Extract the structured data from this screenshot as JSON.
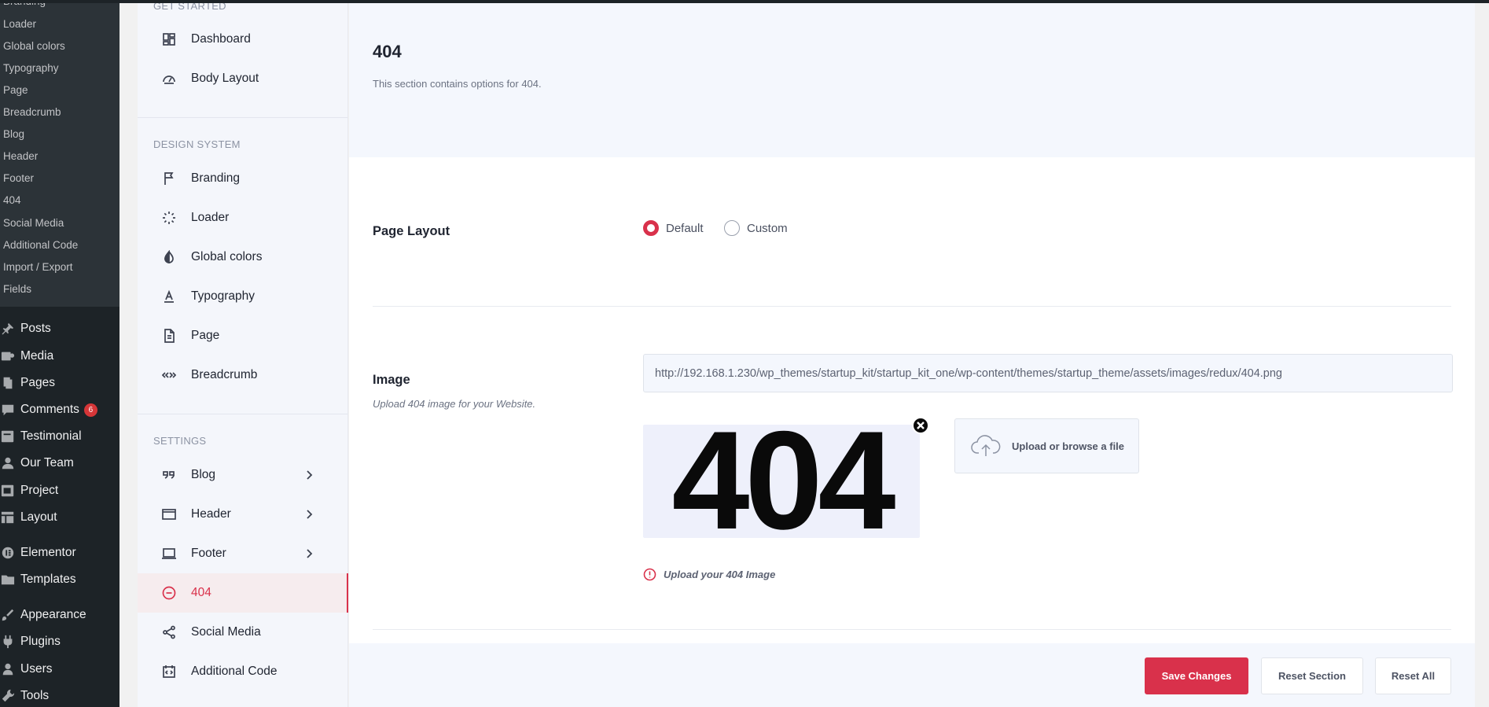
{
  "wp_submenu": [
    "Branding",
    "Loader",
    "Global colors",
    "Typography",
    "Page",
    "Breadcrumb",
    "Blog",
    "Header",
    "Footer",
    "404",
    "Social Media",
    "Additional Code",
    "Import / Export",
    "Fields"
  ],
  "wp_menu": [
    {
      "label": "Posts",
      "icon": "pin-icon"
    },
    {
      "label": "Media",
      "icon": "media-icon"
    },
    {
      "label": "Pages",
      "icon": "pages-icon"
    },
    {
      "label": "Comments",
      "icon": "comments-icon",
      "badge": "6"
    },
    {
      "label": "Testimonial",
      "icon": "testimonial-icon"
    },
    {
      "label": "Our Team",
      "icon": "team-icon"
    },
    {
      "label": "Project",
      "icon": "project-icon"
    },
    {
      "label": "Layout",
      "icon": "layout-icon"
    },
    {
      "label": "Elementor",
      "icon": "elementor-icon"
    },
    {
      "label": "Templates",
      "icon": "folder-icon"
    },
    {
      "label": "Appearance",
      "icon": "brush-icon"
    },
    {
      "label": "Plugins",
      "icon": "plugin-icon"
    },
    {
      "label": "Users",
      "icon": "user-icon"
    },
    {
      "label": "Tools",
      "icon": "wrench-icon"
    }
  ],
  "options_sidebar": {
    "get_started": {
      "label": "GET STARTED",
      "items": [
        {
          "label": "Dashboard",
          "icon": "dashboard-icon"
        },
        {
          "label": "Body Layout",
          "icon": "gauge-icon"
        }
      ]
    },
    "design_system": {
      "label": "DESIGN SYSTEM",
      "items": [
        {
          "label": "Branding",
          "icon": "flag-icon"
        },
        {
          "label": "Loader",
          "icon": "loader-icon"
        },
        {
          "label": "Global colors",
          "icon": "contrast-icon"
        },
        {
          "label": "Typography",
          "icon": "typography-icon"
        },
        {
          "label": "Page",
          "icon": "document-icon"
        },
        {
          "label": "Breadcrumb",
          "icon": "breadcrumb-icon"
        }
      ]
    },
    "settings": {
      "label": "SETTINGS",
      "items": [
        {
          "label": "Blog",
          "icon": "quote-icon",
          "has_children": true
        },
        {
          "label": "Header",
          "icon": "header-icon",
          "has_children": true
        },
        {
          "label": "Footer",
          "icon": "footer-icon",
          "has_children": true
        },
        {
          "label": "404",
          "icon": "minus-circle-icon",
          "active": true
        },
        {
          "label": "Social Media",
          "icon": "share-icon"
        },
        {
          "label": "Additional Code",
          "icon": "code-icon"
        }
      ]
    }
  },
  "section": {
    "title": "404",
    "description": "This section contains options for 404."
  },
  "page_layout": {
    "label": "Page Layout",
    "options": [
      "Default",
      "Custom"
    ],
    "selected": "Default"
  },
  "image_field": {
    "label": "Image",
    "subtitle": "Upload 404 image for your Website.",
    "url": "http://192.168.1.230/wp_themes/startup_kit/startup_kit_one/wp-content/themes/startup_theme/assets/images/redux/404.png",
    "preview_text": "404",
    "upload_label": "Upload or browse a file",
    "hint": "Upload your 404 Image"
  },
  "actions": {
    "save": "Save Changes",
    "reset_section": "Reset Section",
    "reset_all": "Reset All"
  },
  "colors": {
    "accent": "#d9314b",
    "wp_sidebar": "#1d2327",
    "wp_submenu": "#2c3338"
  }
}
